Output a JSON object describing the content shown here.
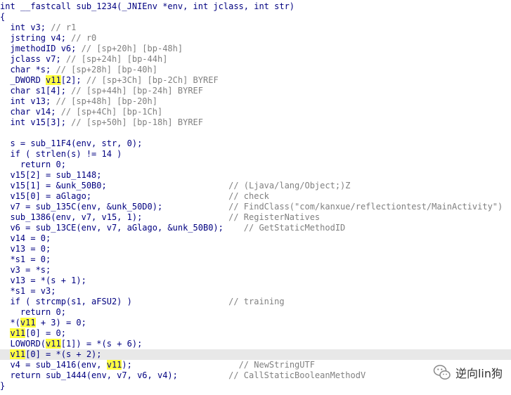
{
  "editor": {
    "lines": [
      {
        "segs": [
          {
            "t": "int __fastcall sub_1234(_JNIEnv *env, int jclass, int str)",
            "k": "p"
          }
        ]
      },
      {
        "segs": [
          {
            "t": "{",
            "k": "p"
          }
        ]
      },
      {
        "segs": [
          {
            "t": "  int v3; ",
            "k": "p"
          },
          {
            "t": "// r1",
            "k": "c"
          }
        ]
      },
      {
        "segs": [
          {
            "t": "  jstring v4; ",
            "k": "p"
          },
          {
            "t": "// r0",
            "k": "c"
          }
        ]
      },
      {
        "segs": [
          {
            "t": "  jmethodID v6; ",
            "k": "p"
          },
          {
            "t": "// [sp+20h] [bp-48h]",
            "k": "c"
          }
        ]
      },
      {
        "segs": [
          {
            "t": "  jclass v7; ",
            "k": "p"
          },
          {
            "t": "// [sp+24h] [bp-44h]",
            "k": "c"
          }
        ]
      },
      {
        "segs": [
          {
            "t": "  char *s; ",
            "k": "p"
          },
          {
            "t": "// [sp+28h] [bp-40h]",
            "k": "c"
          }
        ]
      },
      {
        "segs": [
          {
            "t": "  _DWORD ",
            "k": "p"
          },
          {
            "t": "v11",
            "k": "hl"
          },
          {
            "t": "[2]; ",
            "k": "p"
          },
          {
            "t": "// [sp+3Ch] [bp-2Ch] BYREF",
            "k": "c"
          }
        ]
      },
      {
        "segs": [
          {
            "t": "  char s1[4]; ",
            "k": "p"
          },
          {
            "t": "// [sp+44h] [bp-24h] BYREF",
            "k": "c"
          }
        ]
      },
      {
        "segs": [
          {
            "t": "  int v13; ",
            "k": "p"
          },
          {
            "t": "// [sp+48h] [bp-20h]",
            "k": "c"
          }
        ]
      },
      {
        "segs": [
          {
            "t": "  char v14; ",
            "k": "p"
          },
          {
            "t": "// [sp+4Ch] [bp-1Ch]",
            "k": "c"
          }
        ]
      },
      {
        "segs": [
          {
            "t": "  int v15[3]; ",
            "k": "p"
          },
          {
            "t": "// [sp+50h] [bp-18h] BYREF",
            "k": "c"
          }
        ]
      },
      {
        "segs": [
          {
            "t": "",
            "k": "p"
          }
        ]
      },
      {
        "segs": [
          {
            "t": "  s = sub_11F4(env, str, 0);",
            "k": "p"
          }
        ]
      },
      {
        "segs": [
          {
            "t": "  if ( strlen(s) != 14 )",
            "k": "p"
          }
        ]
      },
      {
        "segs": [
          {
            "t": "    return 0;",
            "k": "p"
          }
        ]
      },
      {
        "segs": [
          {
            "t": "  v15[2] = sub_1148;",
            "k": "p"
          }
        ]
      },
      {
        "segs": [
          {
            "t": "  v15[1] = &unk_50B0;                        ",
            "k": "p"
          },
          {
            "t": "// (Ljava/lang/Object;)Z",
            "k": "c"
          }
        ]
      },
      {
        "segs": [
          {
            "t": "  v15[0] = aGlago;                           ",
            "k": "p"
          },
          {
            "t": "// check",
            "k": "c"
          }
        ]
      },
      {
        "segs": [
          {
            "t": "  v7 = sub_135C(env, &unk_50D0);             ",
            "k": "p"
          },
          {
            "t": "// FindClass(\"com/kanxue/reflectiontest/MainActivity\")",
            "k": "c"
          }
        ]
      },
      {
        "segs": [
          {
            "t": "  sub_1386(env, v7, v15, 1);                 ",
            "k": "p"
          },
          {
            "t": "// RegisterNatives",
            "k": "c"
          }
        ]
      },
      {
        "segs": [
          {
            "t": "  v6 = sub_13CE(env, v7, aGlago, &unk_50B0);    ",
            "k": "p"
          },
          {
            "t": "// GetStaticMethodID",
            "k": "c"
          }
        ]
      },
      {
        "segs": [
          {
            "t": "  v14 = 0;",
            "k": "p"
          }
        ]
      },
      {
        "segs": [
          {
            "t": "  v13 = 0;",
            "k": "p"
          }
        ]
      },
      {
        "segs": [
          {
            "t": "  *s1 = 0;",
            "k": "p"
          }
        ]
      },
      {
        "segs": [
          {
            "t": "  v3 = *s;",
            "k": "p"
          }
        ]
      },
      {
        "segs": [
          {
            "t": "  v13 = *(s + 1);",
            "k": "p"
          }
        ]
      },
      {
        "segs": [
          {
            "t": "  *s1 = v3;",
            "k": "p"
          }
        ]
      },
      {
        "segs": [
          {
            "t": "  if ( strcmp(s1, aFSU2) )                   ",
            "k": "p"
          },
          {
            "t": "// training",
            "k": "c"
          }
        ]
      },
      {
        "segs": [
          {
            "t": "    return 0;",
            "k": "p"
          }
        ]
      },
      {
        "segs": [
          {
            "t": "  *(",
            "k": "p"
          },
          {
            "t": "v11",
            "k": "hl"
          },
          {
            "t": " + 3) = 0;",
            "k": "p"
          }
        ]
      },
      {
        "segs": [
          {
            "t": "  ",
            "k": "p"
          },
          {
            "t": "v11",
            "k": "hl"
          },
          {
            "t": "[0] = 0;",
            "k": "p"
          }
        ]
      },
      {
        "segs": [
          {
            "t": "  LOWORD(",
            "k": "p"
          },
          {
            "t": "v11",
            "k": "hl"
          },
          {
            "t": "[1]) = *(s + 6);",
            "k": "p"
          }
        ]
      },
      {
        "segs": [
          {
            "t": "  ",
            "k": "p"
          },
          {
            "t": "v11",
            "k": "hl"
          },
          {
            "t": "[0] = *(s + 2);",
            "k": "p"
          }
        ],
        "current": true
      },
      {
        "segs": [
          {
            "t": "  v4 = sub_1416(env, ",
            "k": "p"
          },
          {
            "t": "v11",
            "k": "hl"
          },
          {
            "t": ");                     ",
            "k": "p"
          },
          {
            "t": "// NewStringUTF",
            "k": "c"
          }
        ]
      },
      {
        "segs": [
          {
            "t": "  return sub_1444(env, v7, v6, v4);          ",
            "k": "p"
          },
          {
            "t": "// CallStaticBooleanMethodV",
            "k": "c"
          }
        ]
      },
      {
        "segs": [
          {
            "t": "}",
            "k": "p"
          }
        ]
      }
    ]
  },
  "watermark": {
    "icon": "wechat-icon",
    "text": "逆向lin狗"
  }
}
